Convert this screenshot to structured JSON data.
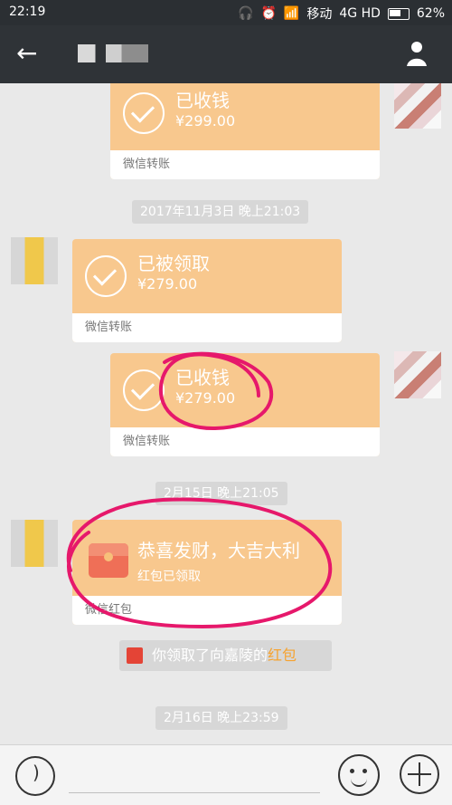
{
  "status": {
    "time": "22:19",
    "carrier": "移动",
    "network": "4G HD",
    "battery": "62%"
  },
  "messages": {
    "m1": {
      "title": "已收钱",
      "amount": "¥299.00",
      "label": "微信转账"
    },
    "t1": "2017年11月3日 晚上21:03",
    "m2": {
      "title": "已被领取",
      "amount": "¥279.00",
      "label": "微信转账"
    },
    "m3": {
      "title": "已收钱",
      "amount": "¥279.00",
      "label": "微信转账"
    },
    "t2": "2月15日 晚上21:05",
    "m4": {
      "title": "恭喜发财，大吉大利",
      "status": "红包已领取",
      "label": "微信红包"
    },
    "notice": {
      "text": "你领取了向嘉陵的",
      "link": "红包"
    },
    "t3": "2月16日 晚上23:59"
  },
  "icons": {
    "voice": "voice-icon",
    "emoji": "emoji-icon",
    "plus": "plus-icon",
    "back": "back-arrow-icon",
    "profile": "profile-icon"
  },
  "colors": {
    "header": "#2f3337",
    "bubble": "#f8c88e",
    "highlight": "#e6186b",
    "link": "#f6a330"
  }
}
